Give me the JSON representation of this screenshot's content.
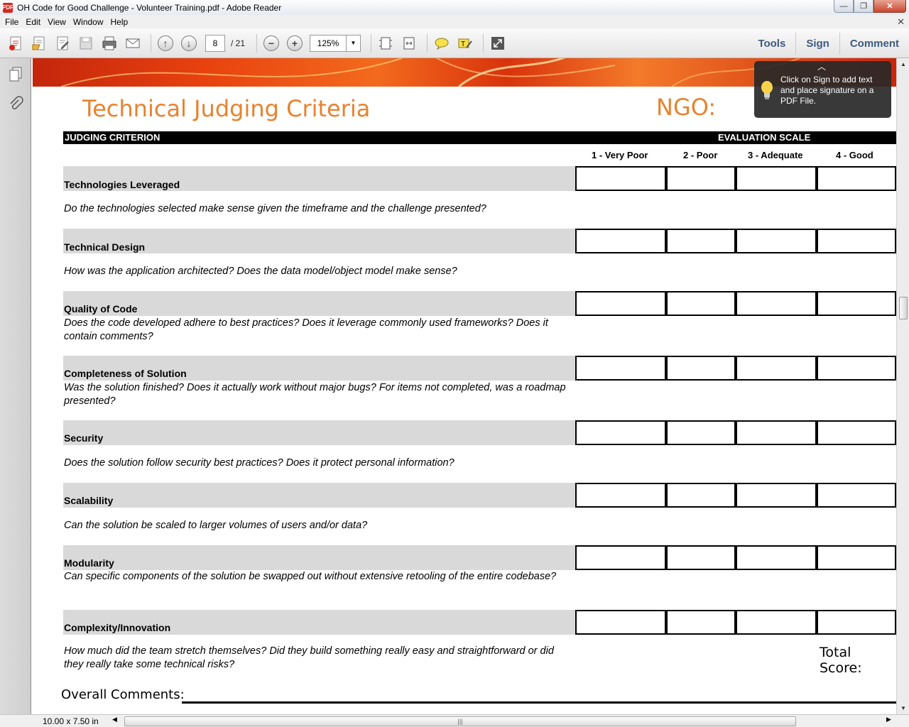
{
  "window": {
    "title": "OH Code for Good Challenge - Volunteer Training.pdf - Adobe Reader",
    "app_icon_label": "PDF"
  },
  "menu": [
    "File",
    "Edit",
    "View",
    "Window",
    "Help"
  ],
  "toolbar": {
    "page_current": "8",
    "page_total": "/ 21",
    "zoom": "125%",
    "tabs": [
      "Tools",
      "Sign",
      "Comment"
    ]
  },
  "tooltip": {
    "text": "Click on Sign to add text and place signature on a PDF File."
  },
  "document": {
    "title": "Technical Judging Criteria",
    "ngo_label": "NGO:",
    "header_left": "JUDGING CRITERION",
    "header_right": "EVALUATION SCALE",
    "scale": [
      "1 - Very Poor",
      "2 - Poor",
      "3 - Adequate",
      "4 - Good"
    ],
    "criteria": [
      {
        "name": "Technologies Leveraged",
        "description": "Do the technologies selected make sense given the timeframe and the challenge presented?"
      },
      {
        "name": "Technical Design",
        "description": "How was the application architected? Does the data model/object model make sense?"
      },
      {
        "name": "Quality of Code",
        "description": "Does the code developed adhere to best practices? Does it leverage commonly used frameworks? Does it contain comments?"
      },
      {
        "name": "Completeness of Solution",
        "description": "Was the solution finished? Does it actually work without major bugs? For items not completed, was a roadmap presented?"
      },
      {
        "name": "Security",
        "description": "Does the solution follow security best practices? Does it protect personal information?"
      },
      {
        "name": "Scalability",
        "description": "Can the solution be scaled to larger volumes of users and/or data?"
      },
      {
        "name": "Modularity",
        "description": "Can specific components of the solution be swapped out without extensive retooling of the entire codebase?"
      },
      {
        "name": "Complexity/Innovation",
        "description": "How much did the team stretch themselves? Did they build something really easy and straightforward or did they really take some technical risks?"
      }
    ],
    "total_score_label": "Total Score:",
    "overall_comments_label": "Overall Comments:"
  },
  "status": {
    "page_size": "10.00 x 7.50 in"
  },
  "colors": {
    "accent_orange": "#e8822e",
    "row_gray": "#d9d9d9",
    "toolbar_tab_blue": "#3d5a80"
  }
}
